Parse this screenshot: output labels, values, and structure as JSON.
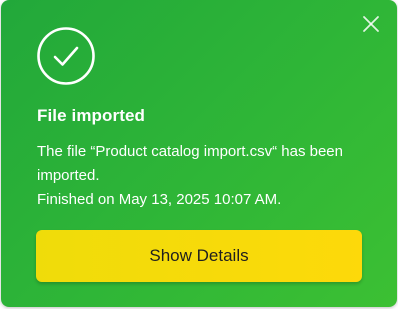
{
  "toast": {
    "title": "File imported",
    "message_line1": "The file “Product catalog import.csv“ has been imported.",
    "message_line2": "Finished on May 13, 2025 10:07 AM.",
    "action_label": "Show Details",
    "status_icon": "check-circle-icon",
    "close_icon": "close-icon"
  },
  "colors": {
    "background_start": "#22a83a",
    "background_end": "#3cc033",
    "button": "#fdd90a",
    "button_text": "#1f1f1f",
    "text": "#ffffff"
  }
}
